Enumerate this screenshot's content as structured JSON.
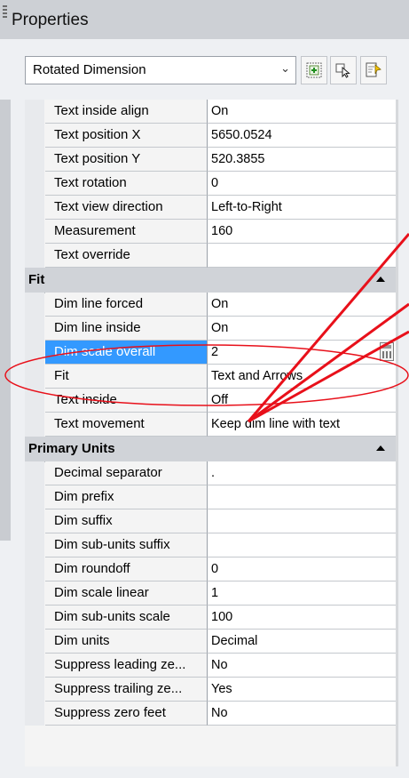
{
  "panel": {
    "title": "Properties"
  },
  "selector": {
    "value": "Rotated Dimension"
  },
  "toolbar": [
    {
      "name": "toggle-pickadd-button",
      "icon": "pickadd-icon"
    },
    {
      "name": "select-objects-button",
      "icon": "select-objects-icon"
    },
    {
      "name": "quick-select-button",
      "icon": "quick-select-icon"
    }
  ],
  "text_rows": [
    {
      "name": "Text inside align",
      "value": "On"
    },
    {
      "name": "Text position X",
      "value": "5650.0524"
    },
    {
      "name": "Text position Y",
      "value": "520.3855"
    },
    {
      "name": "Text rotation",
      "value": "0"
    },
    {
      "name": "Text view direction",
      "value": "Left-to-Right"
    },
    {
      "name": "Measurement",
      "value": "160"
    },
    {
      "name": "Text override",
      "value": ""
    }
  ],
  "fit": {
    "header": "Fit",
    "rows": [
      {
        "name": "Dim line forced",
        "value": "On"
      },
      {
        "name": "Dim line inside",
        "value": "On"
      },
      {
        "name": "Dim scale overall",
        "value": "2"
      },
      {
        "name": "Fit",
        "value": "Text and Arrows"
      },
      {
        "name": "Text inside",
        "value": "Off"
      },
      {
        "name": "Text movement",
        "value": "Keep dim line with text"
      }
    ]
  },
  "primary_units": {
    "header": "Primary Units",
    "rows": [
      {
        "name": "Decimal separator",
        "value": "."
      },
      {
        "name": "Dim prefix",
        "value": ""
      },
      {
        "name": "Dim suffix",
        "value": ""
      },
      {
        "name": "Dim sub-units suffix",
        "value": ""
      },
      {
        "name": "Dim roundoff",
        "value": "0"
      },
      {
        "name": "Dim scale linear",
        "value": "1"
      },
      {
        "name": "Dim sub-units scale",
        "value": "100"
      },
      {
        "name": "Dim units",
        "value": "Decimal"
      },
      {
        "name": "Suppress leading ze...",
        "value": "No"
      },
      {
        "name": "Suppress trailing ze...",
        "value": "Yes"
      },
      {
        "name": "Suppress zero feet",
        "value": "No"
      }
    ]
  },
  "annotation": {
    "color": "#e8101a",
    "icon": "calculator-icon"
  }
}
